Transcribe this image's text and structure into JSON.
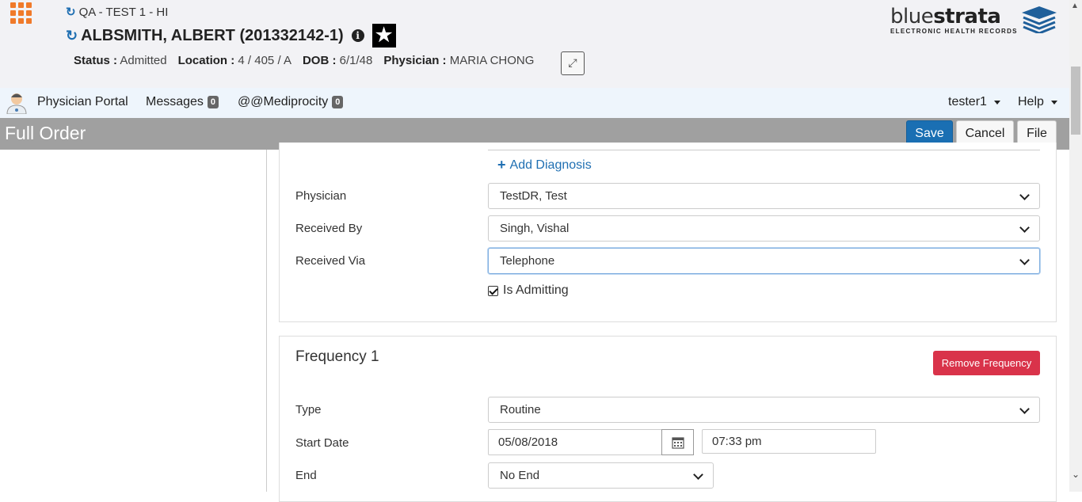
{
  "header": {
    "facility": "QA - TEST 1 - HI",
    "patient_name": "ALBSMITH, ALBERT (201332142-1)",
    "info_icon": "i",
    "star_badge": "★",
    "status_label": "Status :",
    "status_value": "Admitted",
    "location_label": "Location :",
    "location_value": "4 / 405 / A",
    "dob_label": "DOB :",
    "dob_value": "6/1/48",
    "physician_label": "Physician :",
    "physician_value": "MARIA CHONG",
    "logo_light": "blue",
    "logo_bold": "strata",
    "logo_sub": "ELECTRONIC HEALTH RECORDS"
  },
  "nav": {
    "portal": "Physician Portal",
    "messages": "Messages",
    "messages_count": "0",
    "mediprocity": "@@Mediprocity",
    "mediprocity_count": "0",
    "user": "tester1",
    "help": "Help"
  },
  "titlebar": {
    "title": "Full Order",
    "save": "Save",
    "cancel": "Cancel",
    "file": "File"
  },
  "order": {
    "add_diagnosis": "Add Diagnosis",
    "physician_label": "Physician",
    "physician_value": "TestDR, Test",
    "received_by_label": "Received By",
    "received_by_value": "Singh, Vishal",
    "received_via_label": "Received Via",
    "received_via_value": "Telephone",
    "is_admitting_label": "Is Admitting",
    "is_admitting_checked": true
  },
  "frequency": {
    "title": "Frequency 1",
    "remove": "Remove Frequency",
    "type_label": "Type",
    "type_value": "Routine",
    "start_date_label": "Start Date",
    "start_date_value": "05/08/2018",
    "start_time_value": "07:33 pm",
    "end_label": "End",
    "end_value": "No End"
  },
  "colors": {
    "accent": "#1a6fb3",
    "danger": "#d9334a",
    "titlebar": "#a0a0a0",
    "apps": "#f07a2a"
  }
}
